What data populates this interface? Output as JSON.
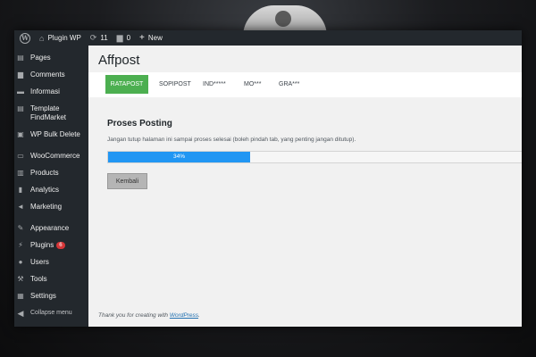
{
  "admin_bar": {
    "site_name": "Plugin WP",
    "updates_count": "11",
    "comments_count": "0",
    "new_label": "New"
  },
  "sidebar": {
    "items": [
      {
        "label": "Pages",
        "icon": "pages-icon"
      },
      {
        "label": "Comments",
        "icon": "comments-icon"
      },
      {
        "label": "Informasi",
        "icon": "info-icon"
      },
      {
        "label": "Template FindMarket",
        "icon": "template-icon"
      },
      {
        "label": "WP Bulk Delete",
        "icon": "bulk-delete-icon"
      },
      {
        "label": "WooCommerce",
        "icon": "woocommerce-icon"
      },
      {
        "label": "Products",
        "icon": "products-icon"
      },
      {
        "label": "Analytics",
        "icon": "analytics-icon"
      },
      {
        "label": "Marketing",
        "icon": "marketing-icon"
      },
      {
        "label": "Appearance",
        "icon": "appearance-icon"
      },
      {
        "label": "Plugins",
        "icon": "plugins-icon",
        "badge": "6"
      },
      {
        "label": "Users",
        "icon": "users-icon"
      },
      {
        "label": "Tools",
        "icon": "tools-icon"
      },
      {
        "label": "Settings",
        "icon": "settings-icon"
      }
    ],
    "collapse_label": "Collapse menu"
  },
  "page": {
    "title": "Affpost",
    "tabs": [
      {
        "label": "RATAPOST",
        "active": true
      },
      {
        "label": "SOPIPOST"
      },
      {
        "label": "IND*****"
      },
      {
        "label": "MO***"
      },
      {
        "label": "GRA***"
      }
    ],
    "section_title": "Proses Posting",
    "description": "Jangan tutup halaman ini sampai proses selesai (boleh pindah tab, yang penting jangan ditutup).",
    "progress": {
      "percent": 34,
      "label": "34%"
    },
    "back_button": "Kembali",
    "footer_prefix": "Thank you for creating with ",
    "footer_link": "WordPress",
    "footer_suffix": "."
  },
  "colors": {
    "admin_dark": "#23282d",
    "tab_active": "#4caf50",
    "progress_fill": "#2196f3"
  }
}
